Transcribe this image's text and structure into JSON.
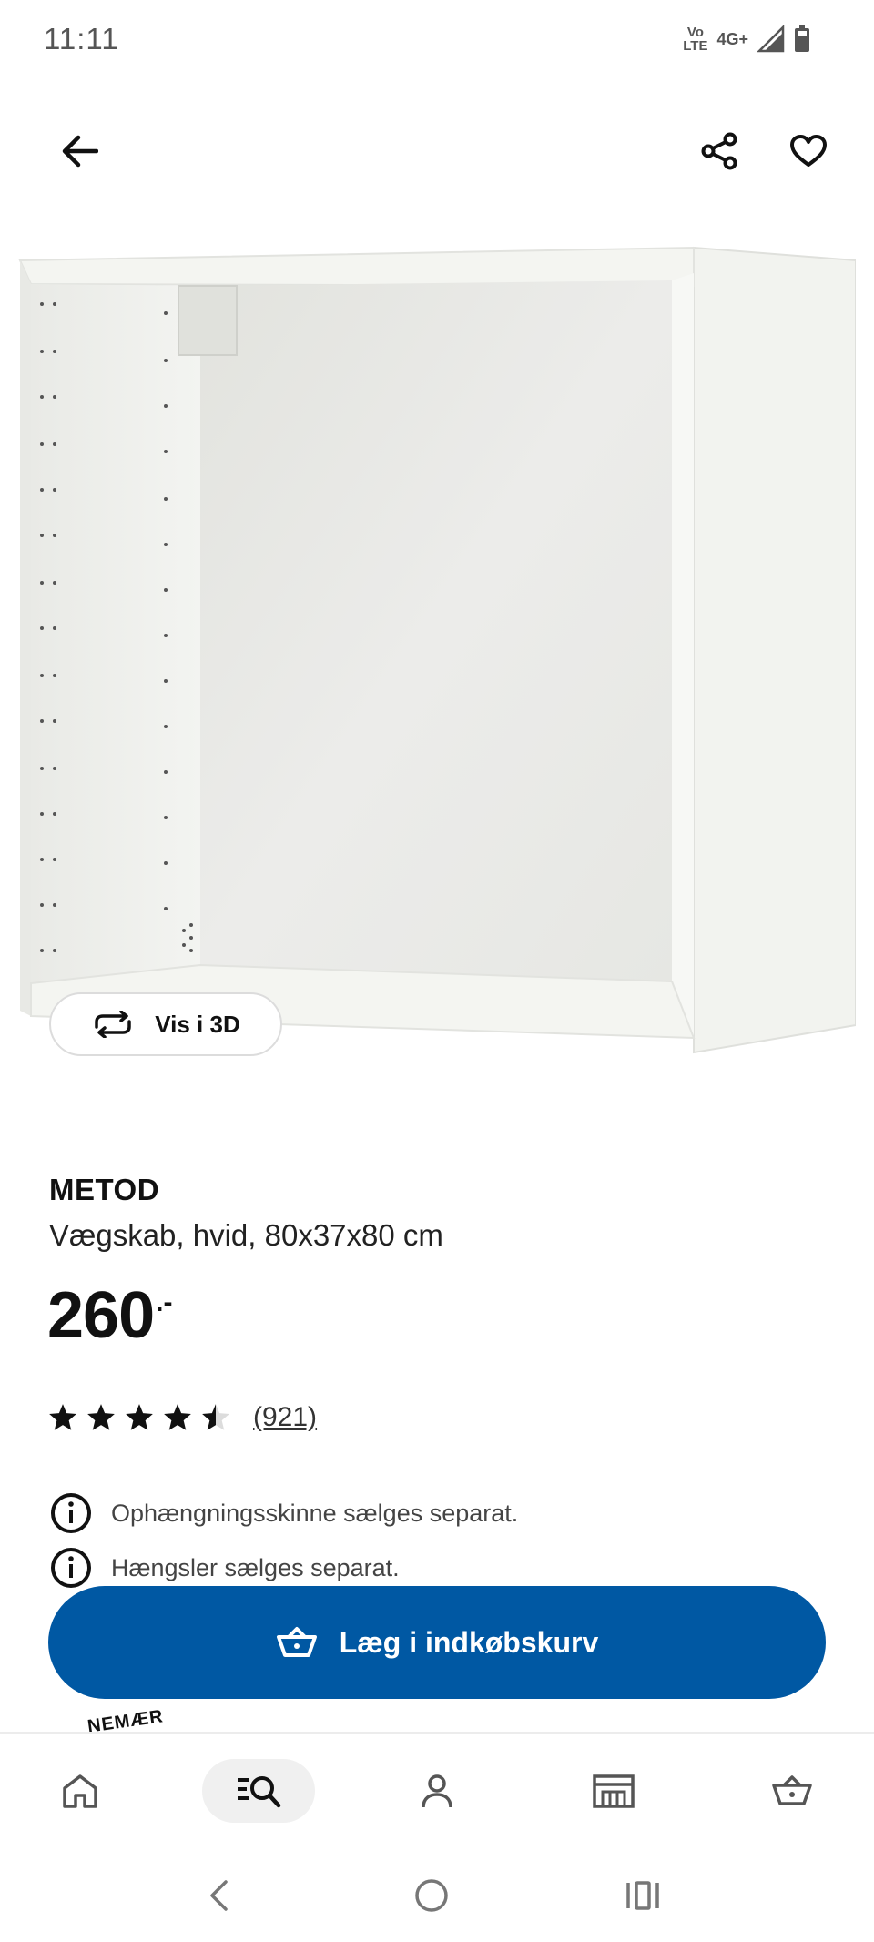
{
  "status_bar": {
    "time": "11:11",
    "volte_top": "Vo",
    "volte_bottom": "LTE",
    "network": "4G+"
  },
  "top_bar": {
    "back_icon": "arrow-left-icon",
    "share_icon": "share-icon",
    "favorite_icon": "heart-icon"
  },
  "product": {
    "view_3d_label": "Vis i 3D",
    "name": "METOD",
    "description": "Vægskab, hvid, 80x37x80 cm",
    "price": "260",
    "price_suffix": ".-",
    "rating": 4.5,
    "rating_max": 5,
    "review_count": "(921)",
    "info": [
      "Ophængningsskinne sælges separat.",
      "Hængsler sælges separat."
    ],
    "add_to_cart_label": "Læg i indkøbskurv",
    "badge_partial_text": "NEMÆR"
  },
  "bottom_nav": {
    "items": [
      "home-icon",
      "search-icon",
      "profile-icon",
      "store-icon",
      "basket-icon"
    ],
    "active": "search-icon"
  },
  "system_nav": [
    "back-icon",
    "home-icon",
    "recents-icon"
  ],
  "colors": {
    "primary_button": "#0058a3",
    "active_nav_bg": "#f0f0f0"
  }
}
